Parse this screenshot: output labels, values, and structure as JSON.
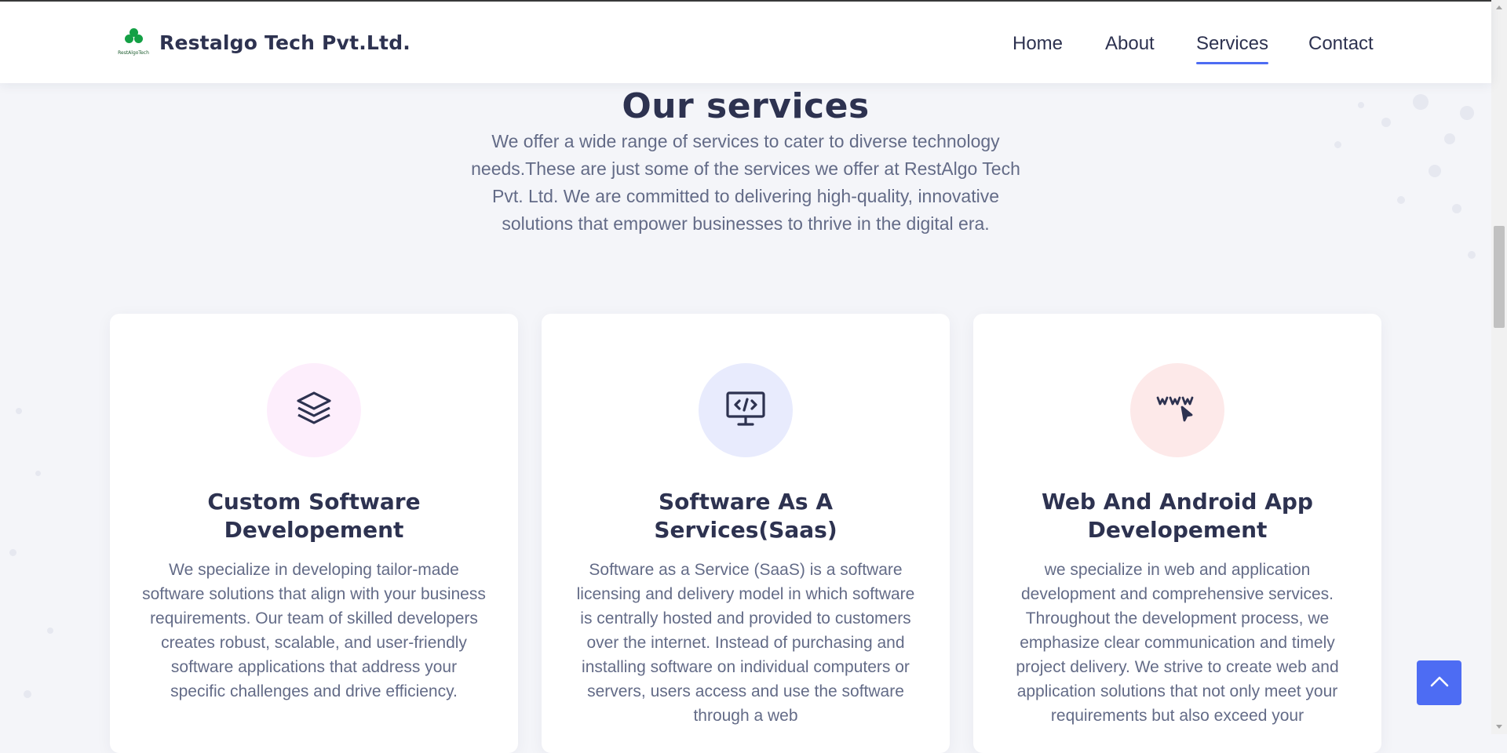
{
  "header": {
    "logo_caption": "RestAlgoTech",
    "brand_name": "Restalgo Tech Pvt.Ltd.",
    "nav": [
      {
        "label": "Home"
      },
      {
        "label": "About"
      },
      {
        "label": "Services"
      },
      {
        "label": "Contact"
      }
    ],
    "active_nav": "Services"
  },
  "section": {
    "title": "Our services",
    "description": "We offer a wide range of services to cater to diverse technology needs.These are just some of the services we offer at RestAlgo Tech Pvt. Ltd. We are committed to delivering high-quality, innovative solutions that empower businesses to thrive in the digital era."
  },
  "cards": [
    {
      "icon": "layers-icon",
      "icon_bg": "#fdeefc",
      "title": "Custom Software Developement",
      "text": "We specialize in developing tailor-made software solutions that align with your business requirements. Our team of skilled developers creates robust, scalable, and user-friendly software applications that address your specific challenges and drive efficiency."
    },
    {
      "icon": "monitor-code-icon",
      "icon_bg": "#e8ebfd",
      "title": "Software As A Services(Saas)",
      "text": "Software as a Service (SaaS) is a software licensing and delivery model in which software is centrally hosted and provided to customers over the internet. Instead of purchasing and installing software on individual computers or servers, users access and use the software through a web"
    },
    {
      "icon": "www-cursor-icon",
      "icon_bg": "#fde9e9",
      "title": "Web And Android App Developement",
      "text": "we specialize in web and application development and comprehensive services. Throughout the development process, we emphasize clear communication and timely project delivery. We strive to create web and application solutions that not only meet your requirements but also exceed your"
    }
  ],
  "colors": {
    "accent": "#4d6cf3",
    "heading": "#2d3250",
    "body_text": "#636b87",
    "background": "#f4f5f9"
  },
  "back_to_top_icon": "chevron-up-icon"
}
